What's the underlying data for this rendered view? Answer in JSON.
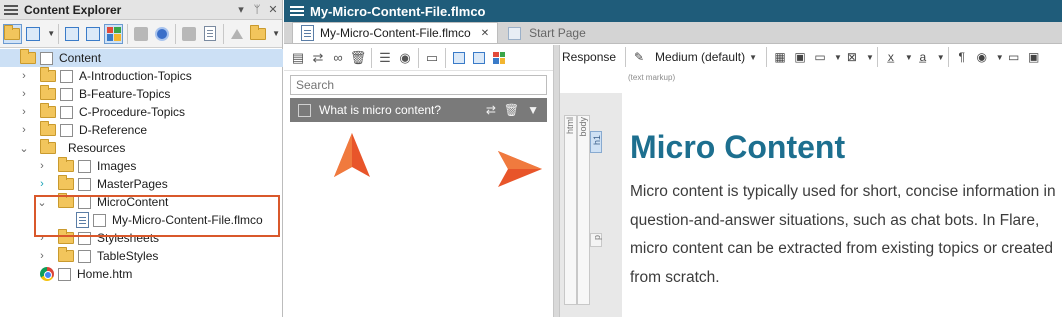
{
  "left_panel": {
    "title": "Content Explorer",
    "title_controls": [
      "▾",
      "ᛘ",
      "✕"
    ],
    "tree": {
      "root": "Content",
      "items": [
        {
          "label": "A-Introduction-Topics",
          "expander": "›",
          "icon": "folder-icon"
        },
        {
          "label": "B-Feature-Topics",
          "expander": "›",
          "icon": "folder-icon"
        },
        {
          "label": "C-Procedure-Topics",
          "expander": "›",
          "icon": "folder-icon"
        },
        {
          "label": "D-Reference",
          "expander": "›",
          "icon": "folder-icon"
        },
        {
          "label": "Resources",
          "expander": "⌄",
          "icon": "open-folder-icon"
        },
        {
          "label": "Images",
          "expander": "›",
          "icon": "folder-icon"
        },
        {
          "label": "MasterPages",
          "expander": "›",
          "icon": "folder-icon"
        },
        {
          "label": "MicroContent",
          "expander": "⌄",
          "icon": "open-folder-icon"
        },
        {
          "label": "My-Micro-Content-File.flmco",
          "expander": "",
          "icon": "file-icon"
        },
        {
          "label": "Stylesheets",
          "expander": "›",
          "icon": "folder-icon"
        },
        {
          "label": "TableStyles",
          "expander": "›",
          "icon": "folder-icon"
        },
        {
          "label": "Home.htm",
          "expander": "",
          "icon": "chrome-icon"
        }
      ]
    }
  },
  "document": {
    "title": "My-Micro-Content-File.flmco",
    "tabs": [
      {
        "label": "My-Micro-Content-File.flmco",
        "close": "✕",
        "active": true
      },
      {
        "label": "Start Page",
        "close": "✕",
        "active": false
      }
    ]
  },
  "micro_list": {
    "search_placeholder": "Search",
    "items": [
      {
        "label": "What is micro content?"
      }
    ]
  },
  "editor": {
    "response_label": "Response",
    "style_select": "Medium (default)",
    "hint": "(text markup)",
    "structure_labels": {
      "html": "html",
      "body": "body",
      "h1": "h1",
      "p": "p"
    },
    "heading": "Micro Content",
    "paragraph": "Micro content is typically used for short, concise information in question-and-answer situations, such as chat bots. In Flare, micro content can be extracted from existing topics or created from scratch."
  },
  "colors": {
    "accent_orange": "#d9582b",
    "title_bar": "#1f5c7a",
    "heading": "#1d6f8f",
    "list_row": "#7a7a7a"
  }
}
